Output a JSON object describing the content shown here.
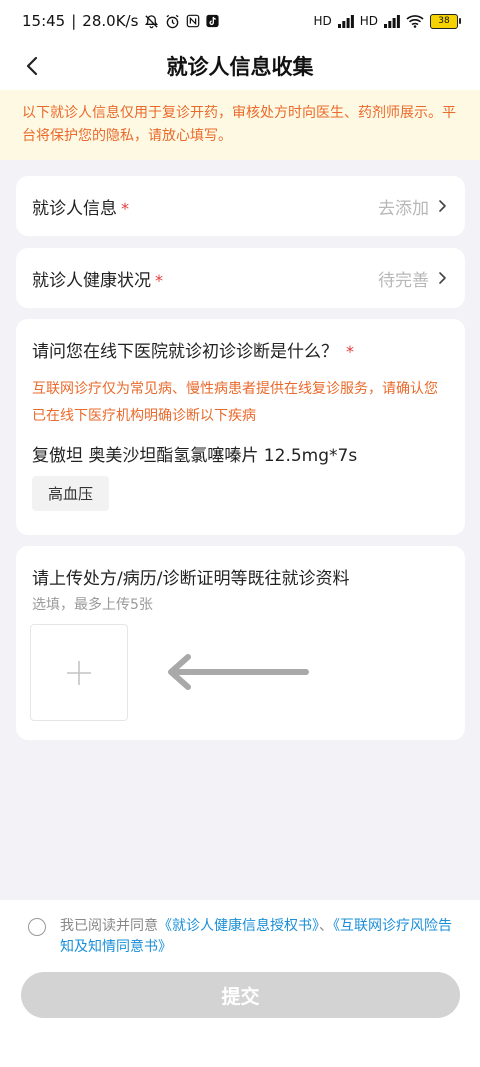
{
  "status_bar": {
    "time": "15:45",
    "separator": "|",
    "speed": "28.0K/s",
    "hd1": "HD",
    "hd2": "HD",
    "battery": "38"
  },
  "nav": {
    "title": "就诊人信息收集"
  },
  "notice": {
    "text": "以下就诊人信息仅用于复诊开药，审核处方时向医生、药剂师展示。平台将保护您的隐私，请放心填写。"
  },
  "patient_info": {
    "label": "就诊人信息",
    "required": "*",
    "action": "去添加"
  },
  "health_status": {
    "label": "就诊人健康状况",
    "required": "*",
    "action": "待完善"
  },
  "diagnosis": {
    "question": "请问您在线下医院就诊初诊诊断是什么？",
    "required": "*",
    "warning": "互联网诊疗仅为常见病、慢性病患者提供在线复诊服务，请确认您已在线下医疗机构明确诊断以下疾病",
    "medicine": "复傲坦 奥美沙坦酯氢氯噻嗪片 12.5mg*7s",
    "tag": "高血压"
  },
  "upload": {
    "title": "请上传处方/病历/诊断证明等既往就诊资料",
    "subtitle": "选填，最多上传5张"
  },
  "agreement": {
    "prefix": "我已阅读并同意",
    "link1": "《就诊人健康信息授权书》",
    "sep": "、",
    "link2": "《互联网诊疗风险告知及知情同意书》"
  },
  "submit_label": "提交",
  "colors": {
    "accent_orange": "#ea6a2c",
    "link_blue": "#1a8fd8",
    "notice_bg": "#fef9e3",
    "required_red": "#e53b3b"
  }
}
